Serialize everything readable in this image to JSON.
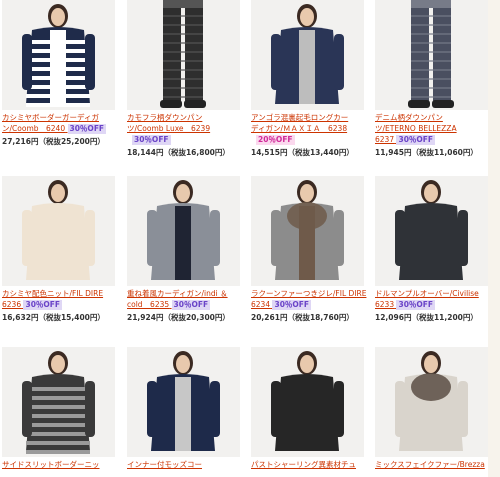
{
  "products": [
    {
      "title_lines": [
        "カシミヤボーダーガーディガ",
        "ン/Coomb　6240"
      ],
      "badge": "30％OFF",
      "badge_color": "purple",
      "badge_row": 1,
      "price": "27,216円",
      "tax_price": "（税抜25,200円）",
      "icon": "cardigan-icon",
      "colors": [
        "#1f2b4a",
        "#ffffff"
      ]
    },
    {
      "title_lines": [
        "カモフラ柄ダウンパン",
        "ツ/Coomb Luxe　6239"
      ],
      "badge": "30％OFF",
      "badge_color": "purple",
      "badge_row": 2,
      "price": "18,144円",
      "tax_price": "（税抜16,800円）",
      "icon": "pants-icon",
      "colors": [
        "#2e2e2e",
        "#555555"
      ]
    },
    {
      "title_lines": [
        "アンゴラ混裏起毛ロングカー",
        "ディガン/ＭＡＸＩＡ　6238"
      ],
      "badge": "20％OFF",
      "badge_color": "pink",
      "badge_row": 2,
      "price": "14,515円",
      "tax_price": "（税抜13,440円）",
      "icon": "long-cardigan-icon",
      "colors": [
        "#2a3556",
        "#bdbdbd"
      ]
    },
    {
      "title_lines": [
        "デニム柄ダウンパン",
        "ツ/ETERNO BELLEZZA",
        "6237"
      ],
      "badge": "30％OFF",
      "badge_color": "purple",
      "badge_row": 3,
      "price": "11,945円",
      "tax_price": "（税抜11,060円）",
      "icon": "denim-pants-icon",
      "colors": [
        "#4a4f60",
        "#777b88"
      ]
    },
    {
      "title_lines": [
        "カシミヤ配色ニット/FIL DIRE",
        "6236"
      ],
      "badge": "30％OFF",
      "badge_color": "purple",
      "badge_row": 2,
      "price": "16,632円",
      "tax_price": "（税抜15,400円）",
      "icon": "knit-icon",
      "colors": [
        "#efe3d2",
        "#d8c8b2"
      ]
    },
    {
      "title_lines": [
        "重ね着風カーディガン/indi ＆",
        "cold　6235"
      ],
      "badge": "30％OFF",
      "badge_color": "purple",
      "badge_row": 2,
      "price": "21,924円",
      "tax_price": "（税抜20,300円）",
      "icon": "vest-cardigan-icon",
      "colors": [
        "#8a8f98",
        "#1f2433"
      ]
    },
    {
      "title_lines": [
        "ラクーンファーつきジレ/FIL DIRE",
        "6234"
      ],
      "badge": "30％OFF",
      "badge_color": "purple",
      "badge_row": 2,
      "price": "20,261円",
      "tax_price": "（税抜18,760円）",
      "icon": "fur-vest-icon",
      "colors": [
        "#8c8c8c",
        "#6f5a4a"
      ]
    },
    {
      "title_lines": [
        "ドルマンプルオーバー/Civilise",
        "6233"
      ],
      "badge": "30％OFF",
      "badge_color": "purple",
      "badge_row": 2,
      "price": "12,096円",
      "tax_price": "（税抜11,200円）",
      "icon": "pullover-icon",
      "colors": [
        "#2f3237",
        "#4a4d52"
      ]
    },
    {
      "title_lines": [
        "サイドスリットボーダーニッ"
      ],
      "badge": "",
      "badge_color": "purple",
      "badge_row": 0,
      "price": "",
      "tax_price": "",
      "icon": "striped-knit-icon",
      "colors": [
        "#3a3a3a",
        "#9a9a9a"
      ]
    },
    {
      "title_lines": [
        "インナー付モッズコー"
      ],
      "badge": "",
      "badge_color": "purple",
      "badge_row": 0,
      "price": "",
      "tax_price": "",
      "icon": "coat-icon",
      "colors": [
        "#1e2a4a",
        "#c7c7c7"
      ]
    },
    {
      "title_lines": [
        "パストシャーリング異素材チュ"
      ],
      "badge": "",
      "badge_color": "purple",
      "badge_row": 0,
      "price": "",
      "tax_price": "",
      "icon": "tunic-icon",
      "colors": [
        "#262626",
        "#555555"
      ]
    },
    {
      "title_lines": [
        "ミックスフェイクファー/Brezza"
      ],
      "badge": "",
      "badge_color": "purple",
      "badge_row": 0,
      "price": "",
      "tax_price": "",
      "icon": "fur-stole-icon",
      "colors": [
        "#d9d4cc",
        "#5a4d44"
      ]
    }
  ]
}
